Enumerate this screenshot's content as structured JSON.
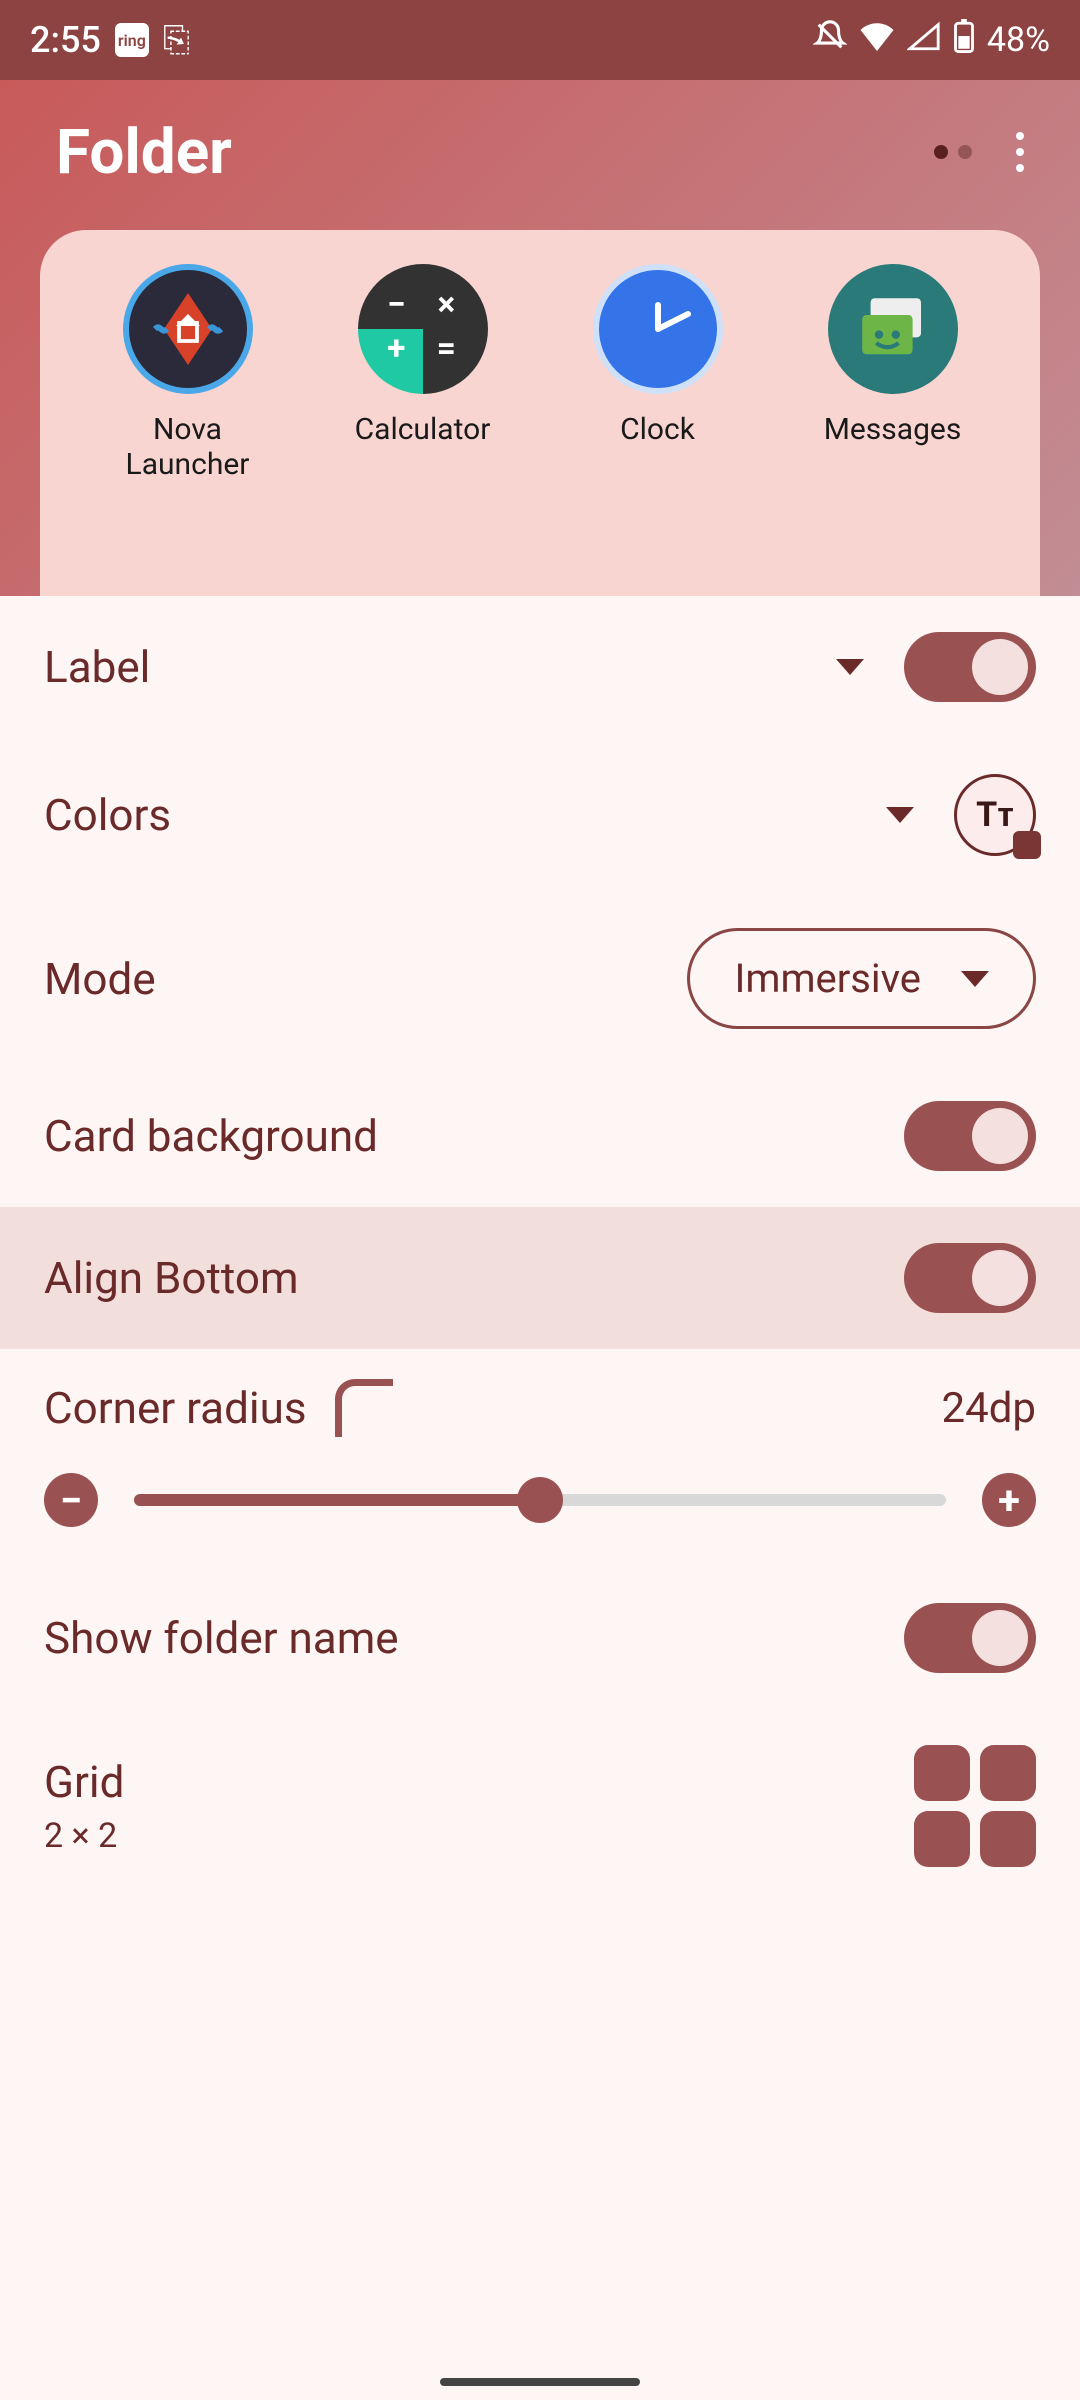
{
  "status": {
    "time": "2:55",
    "battery": "48%"
  },
  "folder": {
    "title": "Folder",
    "apps": [
      {
        "label": "Nova Launcher"
      },
      {
        "label": "Calculator"
      },
      {
        "label": "Clock"
      },
      {
        "label": "Messages"
      }
    ]
  },
  "settings": {
    "label": {
      "title": "Label"
    },
    "colors": {
      "title": "Colors",
      "badge": "Tᴛ"
    },
    "mode": {
      "title": "Mode",
      "value": "Immersive"
    },
    "card_bg": {
      "title": "Card background"
    },
    "align_bottom": {
      "title": "Align Bottom"
    },
    "corner": {
      "title": "Corner radius",
      "value": "24dp"
    },
    "show_name": {
      "title": "Show folder name"
    },
    "grid": {
      "title": "Grid",
      "value": "2 × 2"
    }
  }
}
